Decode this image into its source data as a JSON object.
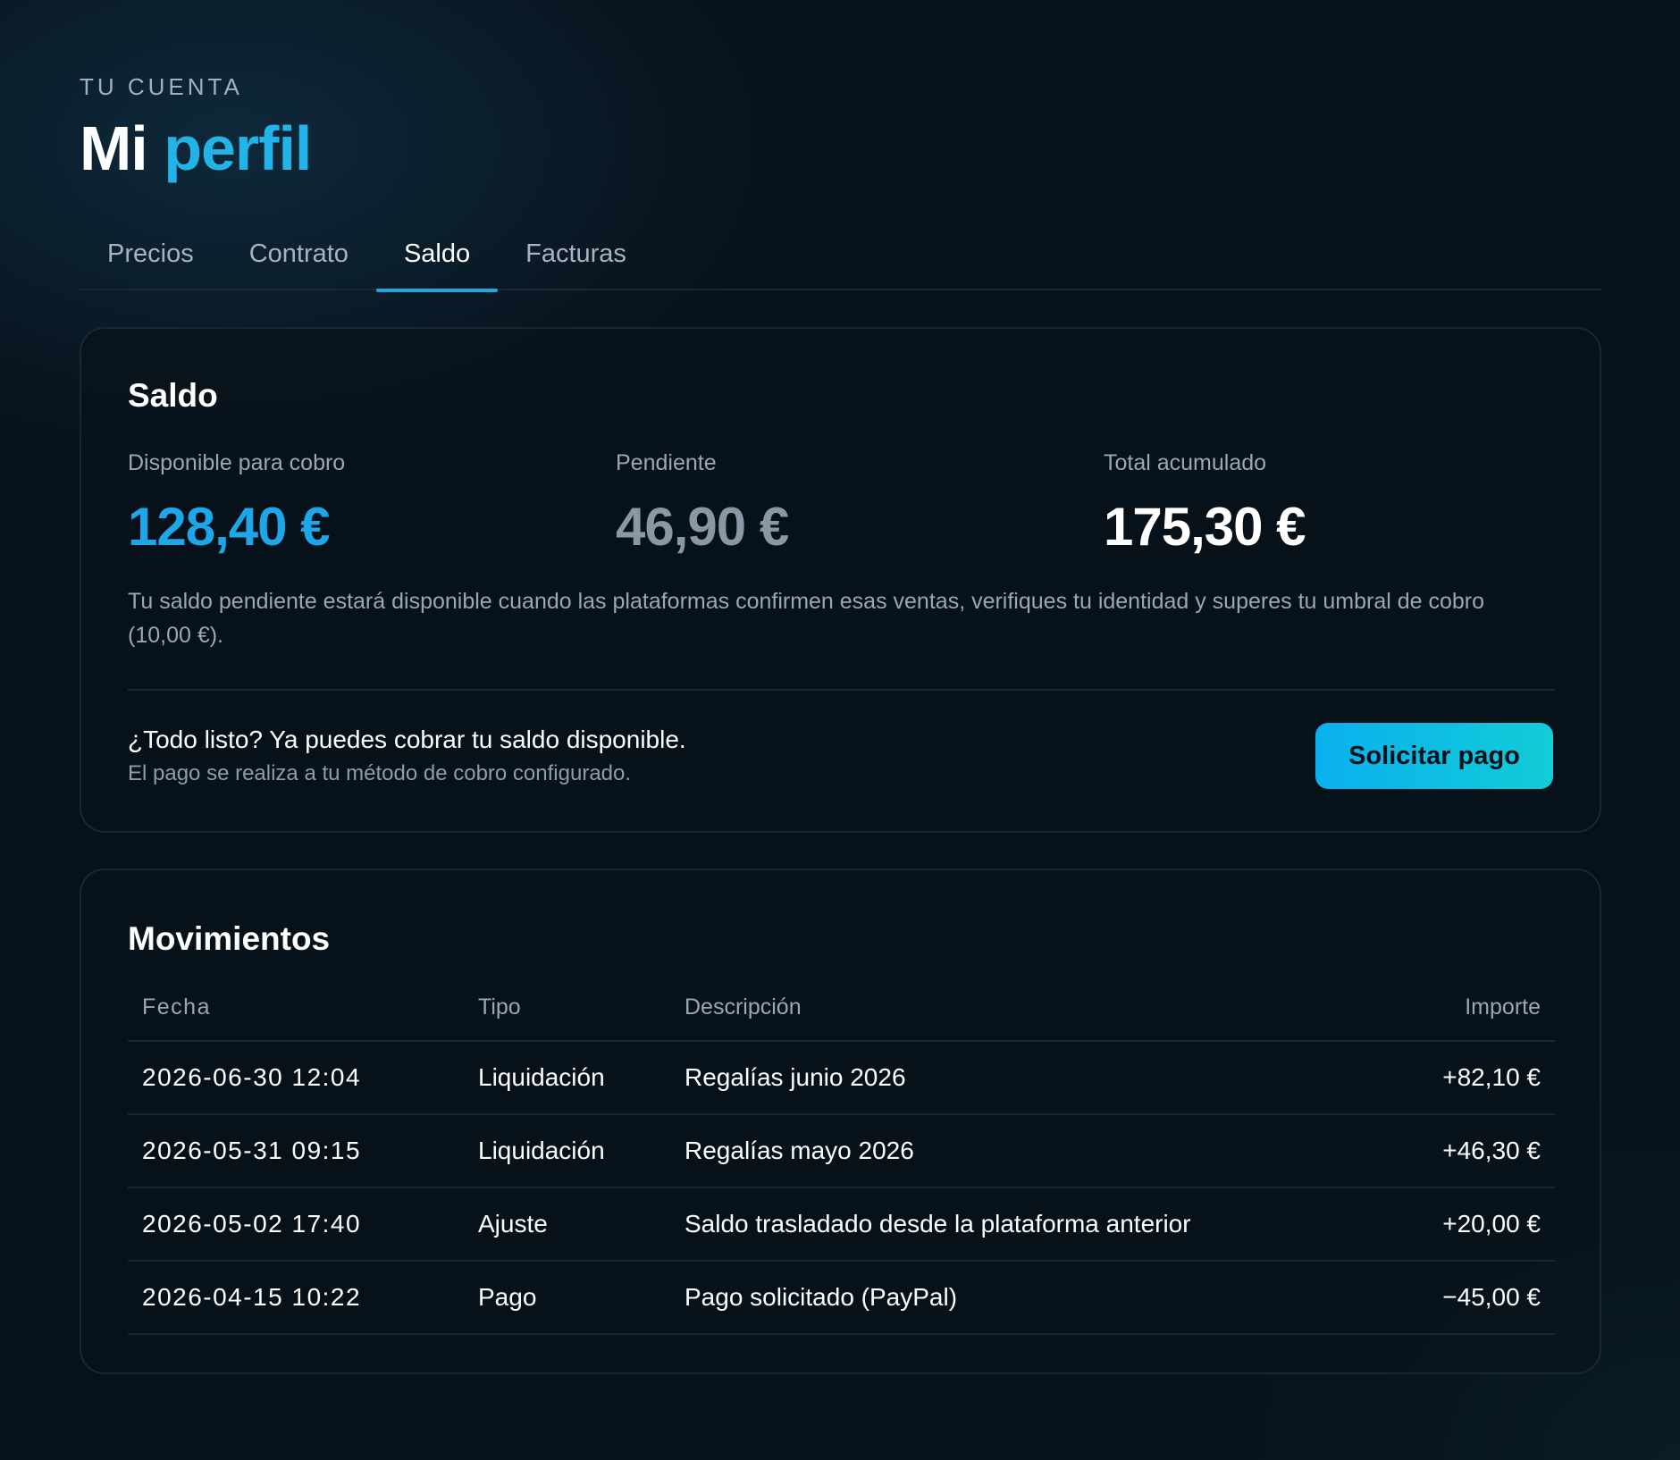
{
  "header": {
    "eyebrow": "TU CUENTA",
    "title_main": "Mi",
    "title_accent": "perfil"
  },
  "tabs": [
    {
      "label": "Precios",
      "active": false
    },
    {
      "label": "Contrato",
      "active": false
    },
    {
      "label": "Saldo",
      "active": true
    },
    {
      "label": "Facturas",
      "active": false
    }
  ],
  "saldo": {
    "title": "Saldo",
    "available": {
      "label": "Disponible para cobro",
      "value": "128,40 €"
    },
    "pending": {
      "label": "Pendiente",
      "value": "46,90 €"
    },
    "total": {
      "label": "Total acumulado",
      "value": "175,30 €"
    },
    "note": "Tu saldo pendiente estará disponible cuando las plataformas confirmen esas ventas, verifiques tu identidad y superes tu umbral de cobro (10,00 €).",
    "cta_title": "¿Todo listo? Ya puedes cobrar tu saldo disponible.",
    "cta_subtitle": "El pago se realiza a tu método de cobro configurado.",
    "pay_button": "Solicitar pago"
  },
  "movimientos": {
    "title": "Movimientos",
    "columns": {
      "date": "Fecha",
      "type": "Tipo",
      "description": "Descripción",
      "amount": "Importe"
    },
    "rows": [
      {
        "date": "2026-06-30 12:04",
        "type": "Liquidación",
        "description": "Regalías junio 2026",
        "amount": "+82,10 €"
      },
      {
        "date": "2026-05-31 09:15",
        "type": "Liquidación",
        "description": "Regalías mayo 2026",
        "amount": "+46,30 €"
      },
      {
        "date": "2026-05-02 17:40",
        "type": "Ajuste",
        "description": "Saldo trasladado desde la plataforma anterior",
        "amount": "+20,00 €"
      },
      {
        "date": "2026-04-15 10:22",
        "type": "Pago",
        "description": "Pago solicitado (PayPal)",
        "amount": "−45,00 €"
      }
    ]
  },
  "colors": {
    "accent": "#22b4e6",
    "positive": "#1ea7e8",
    "negative": "#ef5757",
    "background": "#07111a"
  }
}
